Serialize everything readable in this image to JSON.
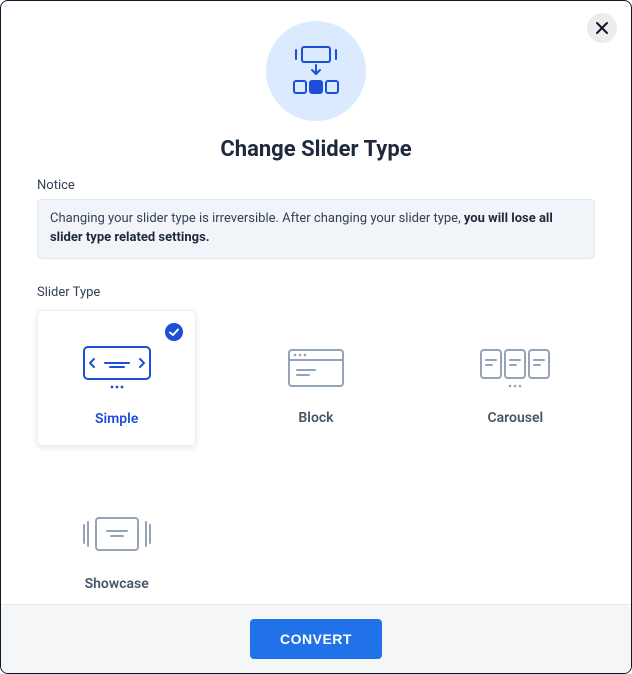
{
  "header": {
    "title": "Change Slider Type"
  },
  "notice": {
    "label": "Notice",
    "text_prefix": "Changing your slider type is irreversible. After changing your slider type, ",
    "text_bold": "you will lose all slider type related settings."
  },
  "slider_type": {
    "label": "Slider Type",
    "options": [
      {
        "id": "simple",
        "label": "Simple",
        "selected": true
      },
      {
        "id": "block",
        "label": "Block",
        "selected": false
      },
      {
        "id": "carousel",
        "label": "Carousel",
        "selected": false
      },
      {
        "id": "showcase",
        "label": "Showcase",
        "selected": false
      }
    ]
  },
  "footer": {
    "convert_label": "CONVERT"
  }
}
